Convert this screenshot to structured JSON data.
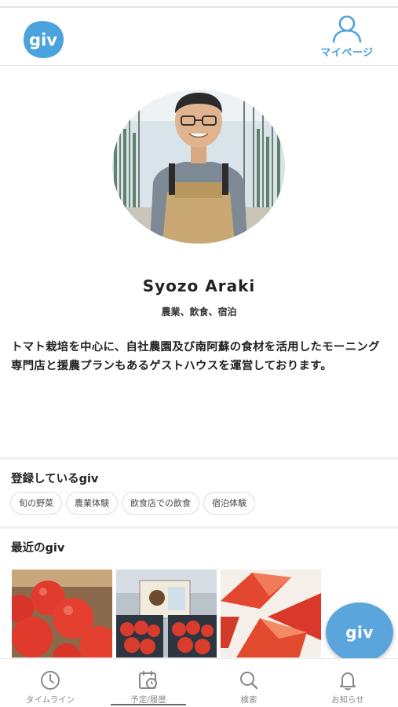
{
  "header": {
    "logo_text": "giv",
    "mypage_label": "マイページ"
  },
  "profile": {
    "name": "Syozo Araki",
    "categories": "農業、飲食、宿泊",
    "bio": "トマト栽培を中心に、自社農園及び南阿蘇の食材を活用したモーニング専門店と援農プランもあるゲストハウスを運営しております。"
  },
  "registered": {
    "title": "登録しているgiv",
    "tags": [
      "旬の野菜",
      "農業体験",
      "飲食店での飲食",
      "宿泊体験"
    ]
  },
  "recent": {
    "title": "最近のgiv"
  },
  "fab": {
    "label": "giv"
  },
  "tabs": [
    {
      "label": "タイムライン",
      "icon": "clock-icon"
    },
    {
      "label": "予定/履歴",
      "icon": "calendar-history-icon"
    },
    {
      "label": "検索",
      "icon": "search-icon"
    },
    {
      "label": "お知らせ",
      "icon": "bell-icon"
    }
  ],
  "colors": {
    "accent": "#4aa3dc",
    "fab": "#5aa6dc",
    "tab_inactive": "#888888"
  }
}
